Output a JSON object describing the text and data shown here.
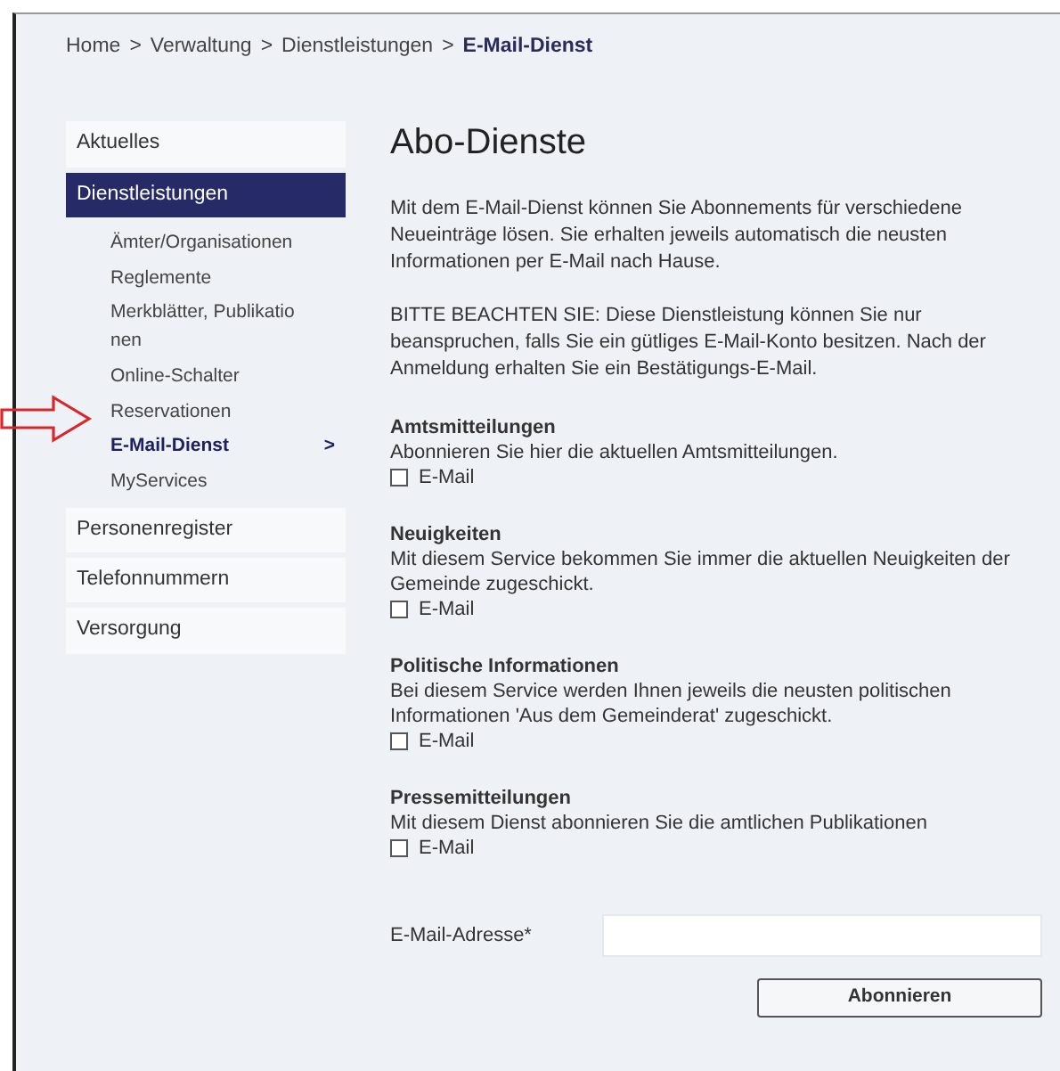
{
  "breadcrumb": {
    "separator": ">",
    "items": [
      {
        "label": "Home",
        "current": false
      },
      {
        "label": "Verwaltung",
        "current": false
      },
      {
        "label": "Dienstleistungen",
        "current": false
      },
      {
        "label": "E-Mail-Dienst",
        "current": true
      }
    ]
  },
  "sidebar": {
    "items": [
      {
        "label": "Aktuelles",
        "selected": false
      },
      {
        "label": "Dienstleistungen",
        "selected": true,
        "children": [
          {
            "label": "Ämter/Organisationen",
            "selected": false
          },
          {
            "label": "Reglemente",
            "selected": false
          },
          {
            "label": "Merkblätter, Publikationen",
            "selected": false
          },
          {
            "label": "Online-Schalter",
            "selected": false
          },
          {
            "label": "Reservationen",
            "selected": false
          },
          {
            "label": "E-Mail-Dienst",
            "selected": true,
            "chevron": ">"
          },
          {
            "label": "MyServices",
            "selected": false
          }
        ]
      },
      {
        "label": "Personenregister",
        "selected": false
      },
      {
        "label": "Telefonnummern",
        "selected": false
      },
      {
        "label": "Versorgung",
        "selected": false
      }
    ]
  },
  "main": {
    "title": "Abo-Dienste",
    "paragraphs": [
      "Mit dem E-Mail-Dienst können Sie Abonnements für verschiedene Neueinträge lösen. Sie erhalten jeweils automatisch die neusten Informationen per E-Mail nach Hause.",
      "BITTE BEACHTEN SIE: Diese Dienstleistung können Sie nur beanspruchen, falls Sie ein gütliges E-Mail-Konto besitzen. Nach der Anmeldung erhalten Sie ein Bestätigungs-E-Mail."
    ],
    "subscriptions": [
      {
        "title": "Amtsmitteilungen",
        "description": "Abonnieren Sie hier die aktuellen Amtsmitteilungen.",
        "option": "E-Mail",
        "checked": false
      },
      {
        "title": "Neuigkeiten",
        "description": "Mit diesem Service bekommen Sie immer die aktuellen Neuigkeiten der Gemeinde zugeschickt.",
        "option": "E-Mail",
        "checked": false
      },
      {
        "title": "Politische Informationen",
        "description": "Bei diesem Service werden Ihnen jeweils die neusten politischen Informationen 'Aus dem Gemeinderat' zugeschickt.",
        "option": "E-Mail",
        "checked": false
      },
      {
        "title": "Pressemitteilungen",
        "description": "Mit diesem Dienst abonnieren Sie die amtlichen Publikationen",
        "option": "E-Mail",
        "checked": false
      }
    ],
    "email_label": "E-Mail-Adresse*",
    "submit": "Abonnieren"
  }
}
